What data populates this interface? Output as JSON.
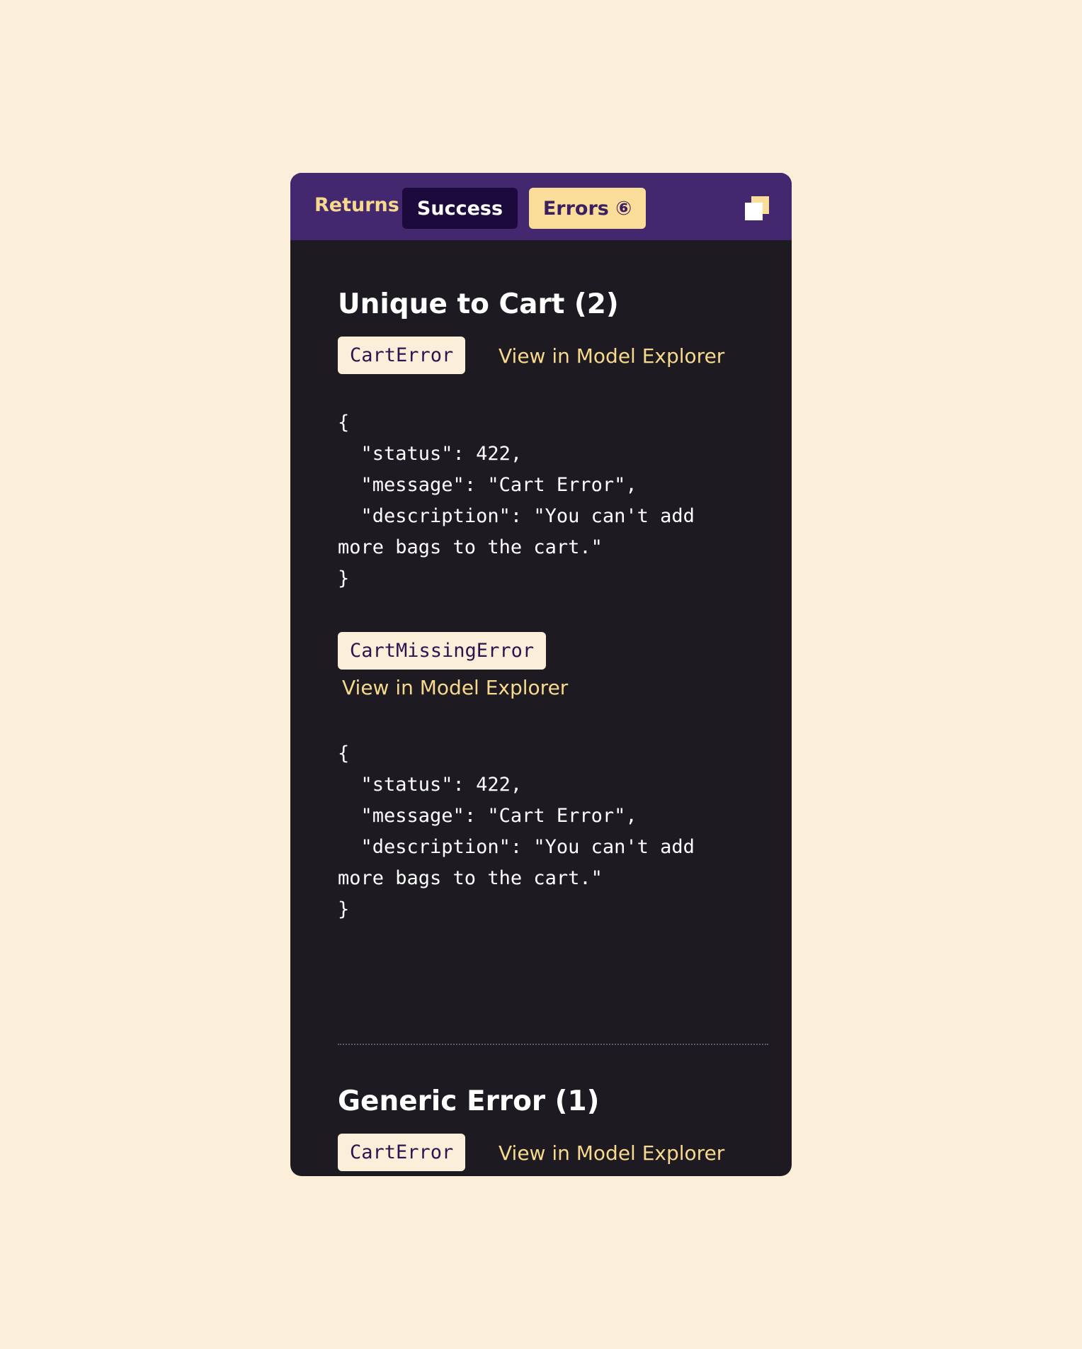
{
  "header": {
    "returns_label": "Returns",
    "tabs": [
      {
        "label": "Success",
        "active": false
      },
      {
        "label": "Errors ⑥",
        "active": true
      }
    ],
    "copy_icon": "copy-icon"
  },
  "sections": [
    {
      "title": "Unique to Cart (2)",
      "errors": [
        {
          "name": "CartError",
          "link": "View in Model Explorer",
          "code": "{\n  \"status\": 422,\n  \"message\": \"Cart Error\",\n  \"description\": \"You can't add more bags to the cart.\"\n}"
        },
        {
          "name": "CartMissingError",
          "link": "View in Model Explorer",
          "code": "{\n  \"status\": 422,\n  \"message\": \"Cart Error\",\n  \"description\": \"You can't add more bags to the cart.\"\n}"
        }
      ]
    },
    {
      "title": "Generic Error (1)",
      "errors": [
        {
          "name": "CartError",
          "link": "View in Model Explorer",
          "code": "{"
        }
      ]
    }
  ],
  "colors": {
    "page_background": "#FBEFD9",
    "panel_background": "#1D1A21",
    "header_background": "#43286F",
    "accent_yellow": "#F7D98D",
    "active_tab": "#FBDD9A",
    "success_tab": "#1B0A3B"
  }
}
